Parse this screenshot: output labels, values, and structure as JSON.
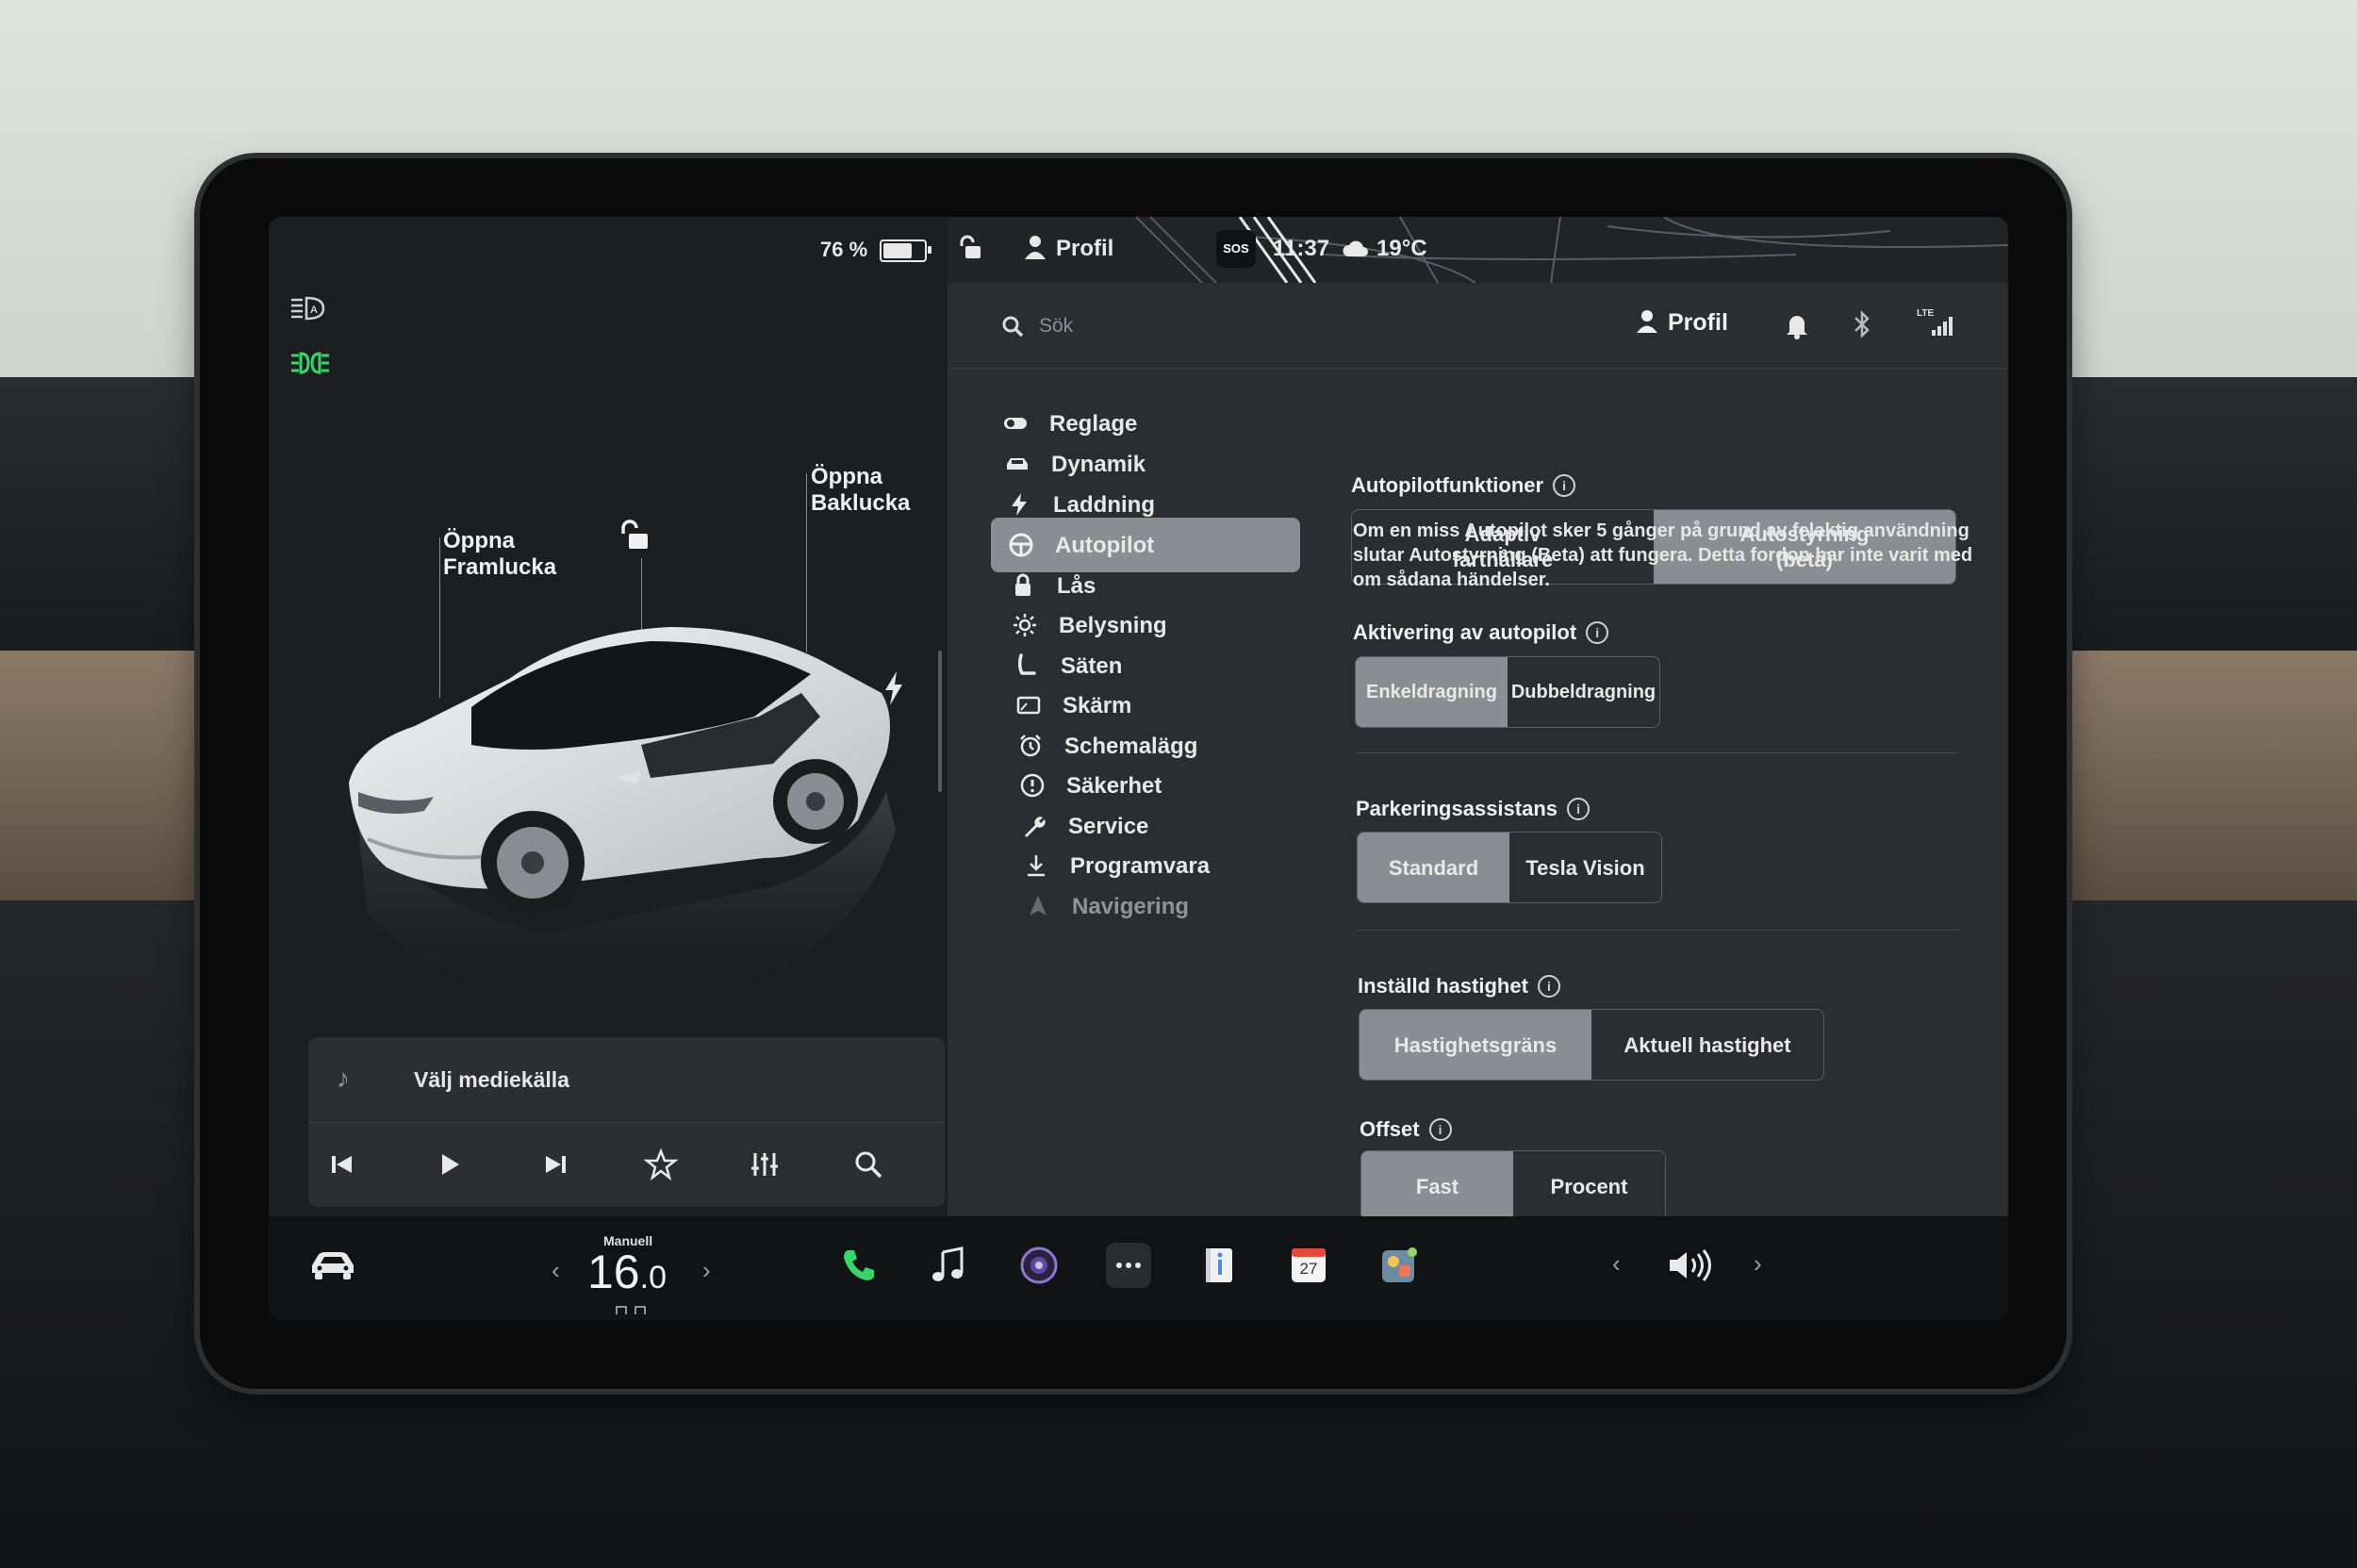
{
  "status_left": {
    "battery_text": "76 %",
    "battery_level": 0.76
  },
  "status_right": {
    "profile": "Profil",
    "sos": "SOS",
    "time": "11:37",
    "temperature": "19°C"
  },
  "car_panel": {
    "front_trunk": {
      "line1": "Öppna",
      "line2": "Framlucka"
    },
    "rear_trunk": {
      "line1": "Öppna",
      "line2": "Baklucka"
    }
  },
  "media": {
    "source_label": "Välj mediekälla"
  },
  "topbar": {
    "search_placeholder": "Sök",
    "profile_label": "Profil"
  },
  "nav": {
    "items": [
      {
        "label": "Reglage",
        "icon": "toggle-icon",
        "active": false
      },
      {
        "label": "Dynamik",
        "icon": "car-icon",
        "active": false
      },
      {
        "label": "Laddning",
        "icon": "bolt-icon",
        "active": false
      },
      {
        "label": "Autopilot",
        "icon": "steering-wheel-icon",
        "active": true
      },
      {
        "label": "Lås",
        "icon": "lock-icon",
        "active": false
      },
      {
        "label": "Belysning",
        "icon": "light-icon",
        "active": false
      },
      {
        "label": "Säten",
        "icon": "seat-icon",
        "active": false
      },
      {
        "label": "Skärm",
        "icon": "display-icon",
        "active": false
      },
      {
        "label": "Schemalägg",
        "icon": "alarm-clock-icon",
        "active": false
      },
      {
        "label": "Säkerhet",
        "icon": "alert-icon",
        "active": false
      },
      {
        "label": "Service",
        "icon": "wrench-icon",
        "active": false
      },
      {
        "label": "Programvara",
        "icon": "download-icon",
        "active": false
      },
      {
        "label": "Navigering",
        "icon": "navigation-icon",
        "active": false
      }
    ]
  },
  "settings": {
    "autopilot_features": {
      "title": "Autopilotfunktioner",
      "options": [
        "Adaptiv farthållare",
        "Autostyrning (beta)"
      ],
      "option_lines": [
        [
          "Adaptiv",
          "farthållare"
        ],
        [
          "Autostyrning",
          "(beta)"
        ]
      ],
      "selected": 1,
      "description": "Om en miss Autopilot sker 5 gånger på grund av felaktig användning slutar Autostyrning (Beta) att fungera. Detta fordon har inte varit med om sådana händelser."
    },
    "activation": {
      "title": "Aktivering av autopilot",
      "options": [
        "Enkeldragning",
        "Dubbeldragning"
      ],
      "selected": 0
    },
    "parking": {
      "title": "Parkeringsassistans",
      "options": [
        "Standard",
        "Tesla Vision"
      ],
      "selected": 0
    },
    "set_speed": {
      "title": "Inställd hastighet",
      "options": [
        "Hastighetsgräns",
        "Aktuell hastighet"
      ],
      "selected": 0
    },
    "offset": {
      "title": "Offset",
      "options": [
        "Fast",
        "Procent"
      ],
      "selected": 0
    }
  },
  "dock": {
    "climate_mode": "Manuell",
    "temperature_int": "16",
    "temperature_dec": ".0",
    "calendar_day": "27"
  },
  "colors": {
    "accent_green": "#36d66b",
    "selected_segment": "#8a8e92",
    "panel_bg": "#2b2d30"
  }
}
